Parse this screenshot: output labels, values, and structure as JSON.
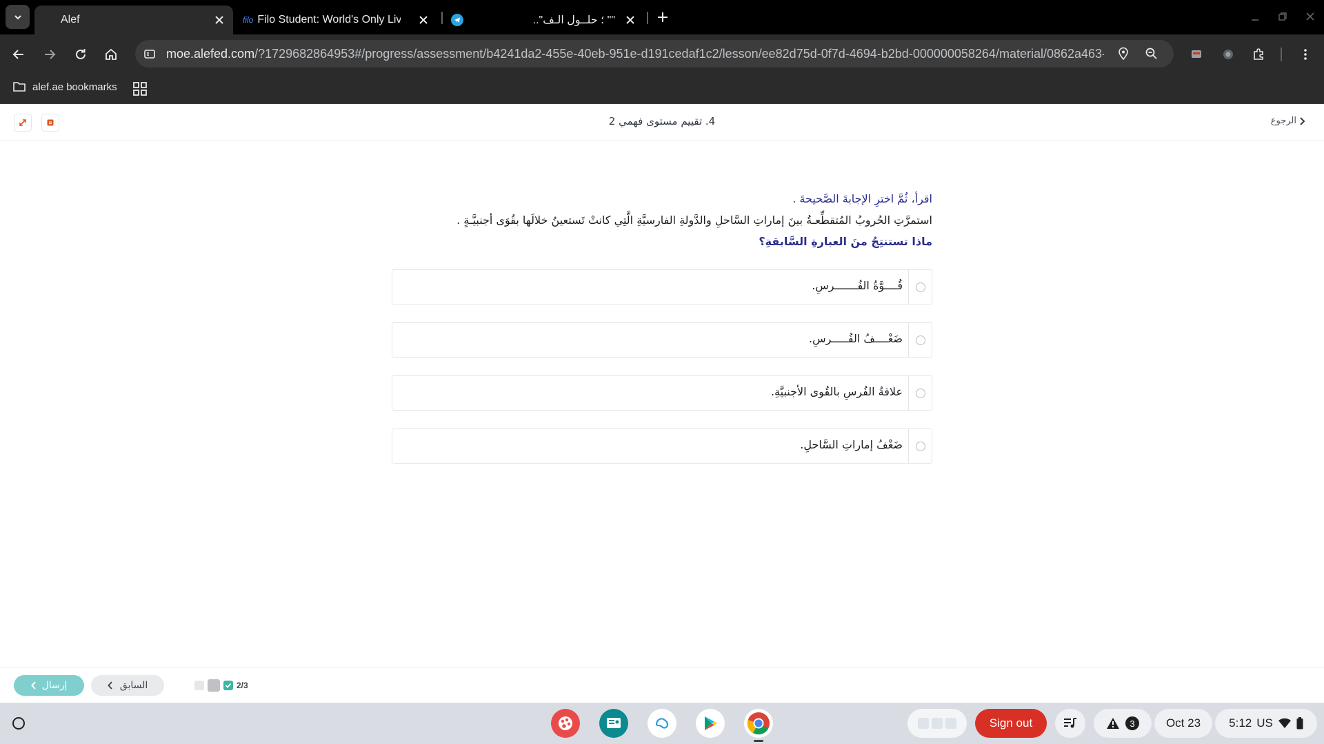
{
  "browser": {
    "tabs": [
      {
        "title": "Alef",
        "active": true
      },
      {
        "title": "Filo Student: World's Only Live I",
        "favicon_text": "filo",
        "active": false
      },
      {
        "title": "\"\" ؛ حلــول الـف\"..",
        "active": false
      }
    ],
    "url_domain": "moe.alefed.com",
    "url_path": "/?1729682864953#/progress/assessment/b4241da2-455e-40eb-951e-d191cedaf1c2/lesson/ee82d75d-0f7d-4694-b2bd-000000058264/material/0862a463-...",
    "bookmarks": [
      {
        "label": "alef.ae bookmarks"
      }
    ]
  },
  "page": {
    "title": "4. تقييم مستوى فهمي 2",
    "back_label": "الرجوع"
  },
  "question": {
    "instruction": "اقرأ، ثُمَّ اخترِ الإجابةَ الصَّحيحةَ .",
    "passage": "استمرَّتِ الحُروبُ المُتقطِّعـةُ بينَ إماراتِ السَّاحلِ والدَّولةِ الفارسيَّةِ الَّتِي كانتْ تَستعينُ خلالَها بقُوَى أجنبيَّـةٍ .",
    "prompt": "ماذا تستنتِجُ منَ العبارةِ السَّابقةِ؟",
    "options": [
      {
        "label": "قُــــوَّةُ الفُـــــــرسِ."
      },
      {
        "label": "ضَعْــــفُ الفُـــــرسِ."
      },
      {
        "label": "علاقةُ الفُرسِ بالقُوى الأجنبيَّةِ."
      },
      {
        "label": "ضَعْفُ إماراتِ السَّاحلِ."
      }
    ]
  },
  "footer": {
    "submit_label": "إرسال",
    "previous_label": "السابق",
    "progress_text": "2/3"
  },
  "shelf": {
    "signout_label": "Sign out",
    "notification_count": "3",
    "date": "Oct 23",
    "time": "5:12",
    "locale": "US"
  },
  "colors": {
    "accent_teal": "#7fcfcf",
    "question_blue": "#2a2f8d",
    "signout_red": "#d93025"
  }
}
